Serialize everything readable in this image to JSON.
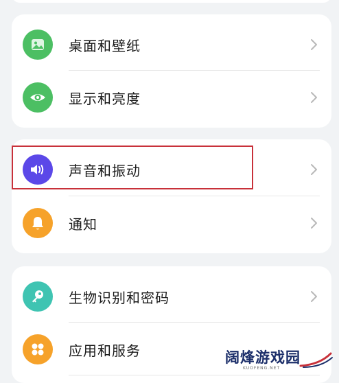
{
  "colors": {
    "background": "#f1f3f5",
    "card": "#ffffff",
    "text": "#1a1a1a",
    "chevron": "#b8b8b8",
    "highlight": "#c8313a",
    "green": "#4cbf63",
    "purple": "#5b48e8",
    "orange": "#f6a22a",
    "teal": "#3fc4b2"
  },
  "settings": {
    "group1": {
      "items": [
        {
          "label": "桌面和壁纸",
          "icon": "image-icon"
        },
        {
          "label": "显示和亮度",
          "icon": "eye-icon"
        }
      ]
    },
    "group2": {
      "items": [
        {
          "label": "声音和振动",
          "icon": "speaker-icon"
        },
        {
          "label": "通知",
          "icon": "bell-icon"
        }
      ]
    },
    "group3": {
      "items": [
        {
          "label": "生物识别和密码",
          "icon": "key-icon"
        },
        {
          "label": "应用和服务",
          "icon": "apps-grid-icon"
        }
      ]
    }
  },
  "watermark": {
    "title": "阔烽游戏园",
    "subtitle": "KUOFENG.NET"
  }
}
